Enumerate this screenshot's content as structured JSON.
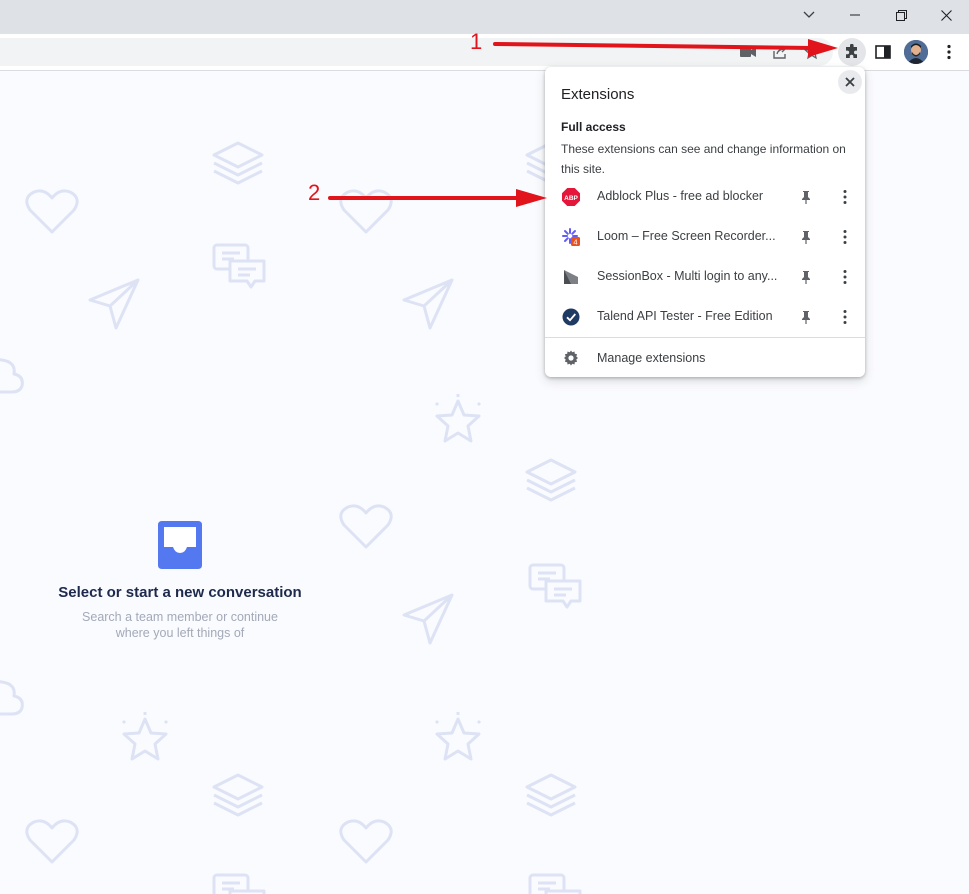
{
  "browser": {
    "window_controls": {
      "tabs_menu": "chevron-down-icon",
      "minimize": "minimize-icon",
      "restore": "restore-icon",
      "close": "close-icon"
    },
    "toolbar_icons": [
      "camera-off-icon",
      "share-icon",
      "star-icon",
      "puzzle-icon",
      "side-panel-icon",
      "avatar",
      "kebab-menu-icon"
    ]
  },
  "extensions_popup": {
    "title": "Extensions",
    "section_title": "Full access",
    "section_description": "These extensions can see and change information on this site.",
    "items": [
      {
        "name": "Adblock Plus - free ad blocker",
        "icon": "adblock-plus-icon",
        "icon_text": "ABP",
        "color": "#e4163a"
      },
      {
        "name": "Loom – Free Screen Recorder...",
        "icon": "loom-icon",
        "badge": "4",
        "color": "#625df5"
      },
      {
        "name": "SessionBox - Multi login to any...",
        "icon": "sessionbox-icon",
        "color": "#5f6368"
      },
      {
        "name": "Talend API Tester - Free Edition",
        "icon": "talend-icon",
        "color": "#1f3b63"
      }
    ],
    "manage_label": "Manage extensions"
  },
  "page": {
    "empty_title": "Select or start a new conversation",
    "empty_subtitle": "Search a team member or continue where you left things of"
  },
  "annotations": {
    "marker_1": "1",
    "marker_2": "2",
    "color": "#e1141c"
  }
}
